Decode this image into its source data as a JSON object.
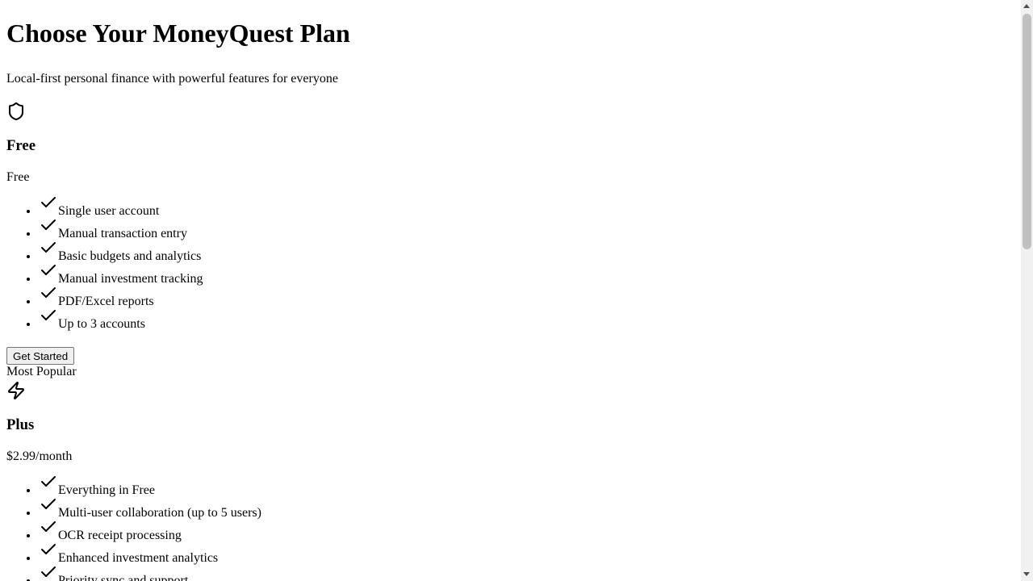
{
  "page": {
    "title": "Choose Your MoneyQuest Plan",
    "subtitle": "Local-first personal finance with powerful features for everyone"
  },
  "plans": [
    {
      "icon": "shield-icon",
      "name": "Free",
      "price": "Free",
      "features": [
        "Single user account",
        "Manual transaction entry",
        "Basic budgets and analytics",
        "Manual investment tracking",
        "PDF/Excel reports",
        "Up to 3 accounts"
      ],
      "cta_label": "Get Started"
    },
    {
      "badge": "Most Popular",
      "icon": "lightning-icon",
      "name": "Plus",
      "price": "$2.99/month",
      "features": [
        "Everything in Free",
        "Multi-user collaboration (up to 5 users)",
        "OCR receipt processing",
        "Enhanced investment analytics",
        "Priority sync and support"
      ]
    }
  ],
  "colors": {
    "text": "#000000",
    "button_bg": "#efefef",
    "button_border": "#767676",
    "scrollbar_track": "#f1f1f1",
    "scrollbar_thumb": "#c1c1c1"
  }
}
